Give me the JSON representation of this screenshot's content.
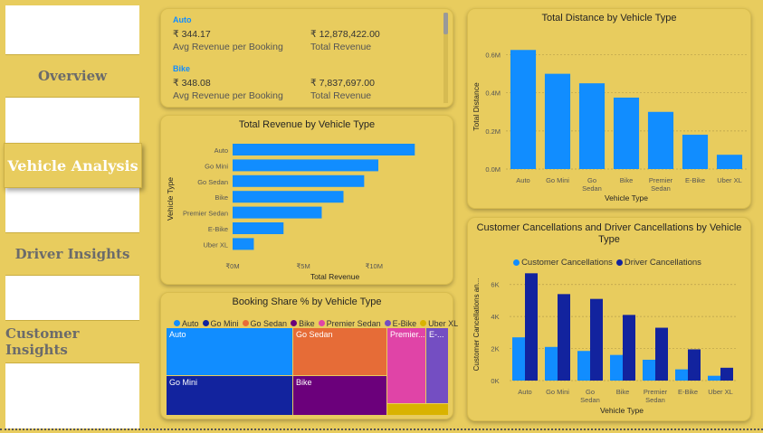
{
  "nav": {
    "overview": "Overview",
    "vehicle_analysis": "Vehicle Analysis",
    "driver_insights": "Driver Insights",
    "customer_insights": "Customer Insights"
  },
  "kpi_cards": [
    {
      "type": "Auto",
      "avg_revenue": "₹ 344.17",
      "avg_label": "Avg Revenue per Booking",
      "total_revenue": "₹ 12,878,422.00",
      "total_label": "Total Revenue"
    },
    {
      "type": "Bike",
      "avg_revenue": "₹ 348.08",
      "avg_label": "Avg Revenue per Booking",
      "total_revenue": "₹ 7,837,697.00",
      "total_label": "Total Revenue"
    }
  ],
  "colors": {
    "background": "#e8cc5e",
    "primary_blue": "#118dff",
    "dark_blue": "#12239e",
    "orange": "#e66c37",
    "purple": "#6b007b",
    "pink": "#e044a7",
    "violet": "#744ec2",
    "gold": "#d9b300"
  },
  "chart_data": [
    {
      "type": "bar",
      "orientation": "horizontal",
      "title": "Total Revenue by Vehicle Type",
      "xlabel": "Total Revenue",
      "ylabel": "Vehicle Type",
      "categories": [
        "Auto",
        "Go Mini",
        "Go Sedan",
        "Bike",
        "Premier Sedan",
        "E-Bike",
        "Uber XL"
      ],
      "values": [
        12878422,
        10300000,
        9300000,
        7837697,
        6300000,
        3600000,
        1500000
      ],
      "xticks": [
        "₹0M",
        "₹5M",
        "₹10M"
      ],
      "xtick_values": [
        0,
        5000000,
        10000000
      ],
      "xlim": [
        0,
        13500000
      ],
      "color": "#118dff"
    },
    {
      "type": "bar",
      "title": "Total Distance by Vehicle Type",
      "xlabel": "Vehicle Type",
      "ylabel": "Total Distance",
      "categories": [
        "Auto",
        "Go Mini",
        "Go Sedan",
        "Bike",
        "Premier Sedan",
        "E-Bike",
        "Uber XL"
      ],
      "values": [
        625000,
        500000,
        450000,
        375000,
        300000,
        180000,
        75000
      ],
      "yticks": [
        "0.0M",
        "0.2M",
        "0.4M",
        "0.6M"
      ],
      "ytick_values": [
        0,
        200000,
        400000,
        600000
      ],
      "ylim": [
        0,
        650000
      ],
      "color": "#118dff"
    },
    {
      "type": "treemap",
      "title": "Booking Share % by Vehicle Type",
      "legend": [
        {
          "name": "Auto",
          "color": "#118dff"
        },
        {
          "name": "Go Mini",
          "color": "#12239e"
        },
        {
          "name": "Go Sedan",
          "color": "#e66c37"
        },
        {
          "name": "Bike",
          "color": "#6b007b"
        },
        {
          "name": "Premier Sedan",
          "color": "#e044a7"
        },
        {
          "name": "E-Bike",
          "color": "#744ec2"
        },
        {
          "name": "Uber XL",
          "color": "#d9b300"
        }
      ],
      "labels": {
        "auto": "Auto",
        "go_mini": "Go Mini",
        "go_sedan": "Go Sedan",
        "bike": "Bike",
        "premier": "Premier...",
        "ebike": "E-..."
      }
    },
    {
      "type": "bar",
      "grouped": true,
      "title": "Customer Cancellations and Driver Cancellations by Vehicle Type",
      "xlabel": "Vehicle Type",
      "ylabel": "Customer Cancellations an...",
      "categories": [
        "Auto",
        "Go Mini",
        "Go Sedan",
        "Bike",
        "Premier Sedan",
        "E-Bike",
        "Uber XL"
      ],
      "series": [
        {
          "name": "Customer Cancellations",
          "color": "#118dff",
          "values": [
            2700,
            2100,
            1850,
            1600,
            1300,
            700,
            300
          ]
        },
        {
          "name": "Driver Cancellations",
          "color": "#12239e",
          "values": [
            6700,
            5400,
            5100,
            4100,
            3300,
            1950,
            800
          ]
        }
      ],
      "yticks": [
        "0K",
        "2K",
        "4K",
        "6K"
      ],
      "ytick_values": [
        0,
        2000,
        4000,
        6000
      ],
      "ylim": [
        0,
        7000
      ],
      "legend_position": "top"
    }
  ]
}
